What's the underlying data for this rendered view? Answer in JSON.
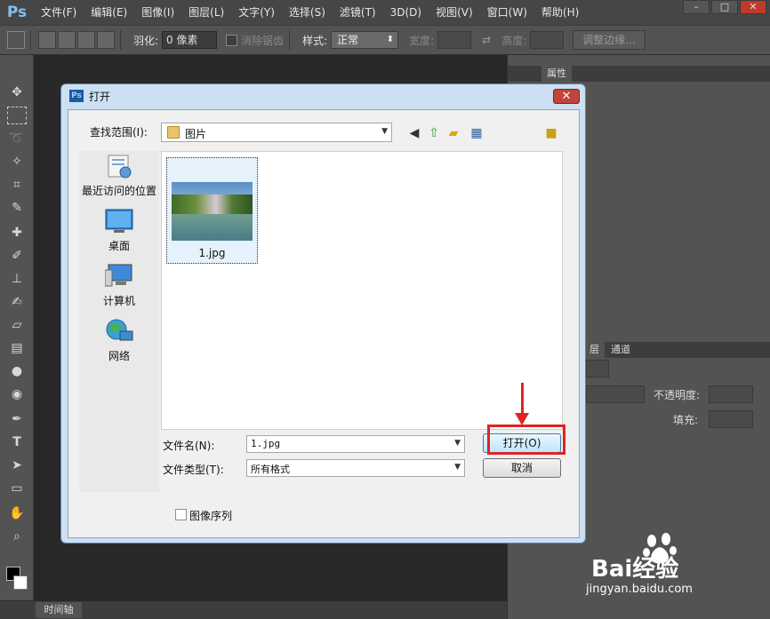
{
  "app": {
    "logo": "Ps",
    "menu": [
      "文件(F)",
      "编辑(E)",
      "图像(I)",
      "图层(L)",
      "文字(Y)",
      "选择(S)",
      "滤镜(T)",
      "3D(D)",
      "视图(V)",
      "窗口(W)",
      "帮助(H)"
    ],
    "window_buttons": [
      "–",
      "□",
      "✕"
    ]
  },
  "options_bar": {
    "feather_label": "羽化:",
    "feather_value": "0 像素",
    "antialias_label": "消除锯齿",
    "style_label": "样式:",
    "style_value": "正常",
    "width_label": "宽度:",
    "height_label": "高度:",
    "refine_edge_label": "调整边缘..."
  },
  "panels": {
    "properties_tab": "属性",
    "layers_tab": "层",
    "channels_tab": "通道",
    "opacity_label": "不透明度:",
    "fill_label": "填充:",
    "timeline_tab": "时间轴"
  },
  "dialog": {
    "title": "打开",
    "ps_icon_text": "Ps",
    "close_symbol": "✕",
    "look_in_label": "查找范围(I):",
    "look_in_value": "图片",
    "places": [
      {
        "label": "最近访问的位置",
        "icon": "recent-places-icon"
      },
      {
        "label": "桌面",
        "icon": "desktop-icon"
      },
      {
        "label": "计算机",
        "icon": "computer-icon"
      },
      {
        "label": "网络",
        "icon": "network-icon"
      }
    ],
    "files": [
      {
        "name": "1.jpg",
        "selected": true
      }
    ],
    "file_name_label": "文件名(N):",
    "file_name_value": "1.jpg",
    "file_type_label": "文件类型(T):",
    "file_type_value": "所有格式",
    "open_button": "打开(O)",
    "cancel_button": "取消",
    "image_sequence_label": "图像序列",
    "image_sequence_checked": false
  },
  "watermark": {
    "brand": "Bai经验",
    "url": "jingyan.baidu.com"
  },
  "colors": {
    "annotation_red": "#e02424",
    "ps_blue": "#7fbff0",
    "dialog_frame": "#cde0f3"
  }
}
